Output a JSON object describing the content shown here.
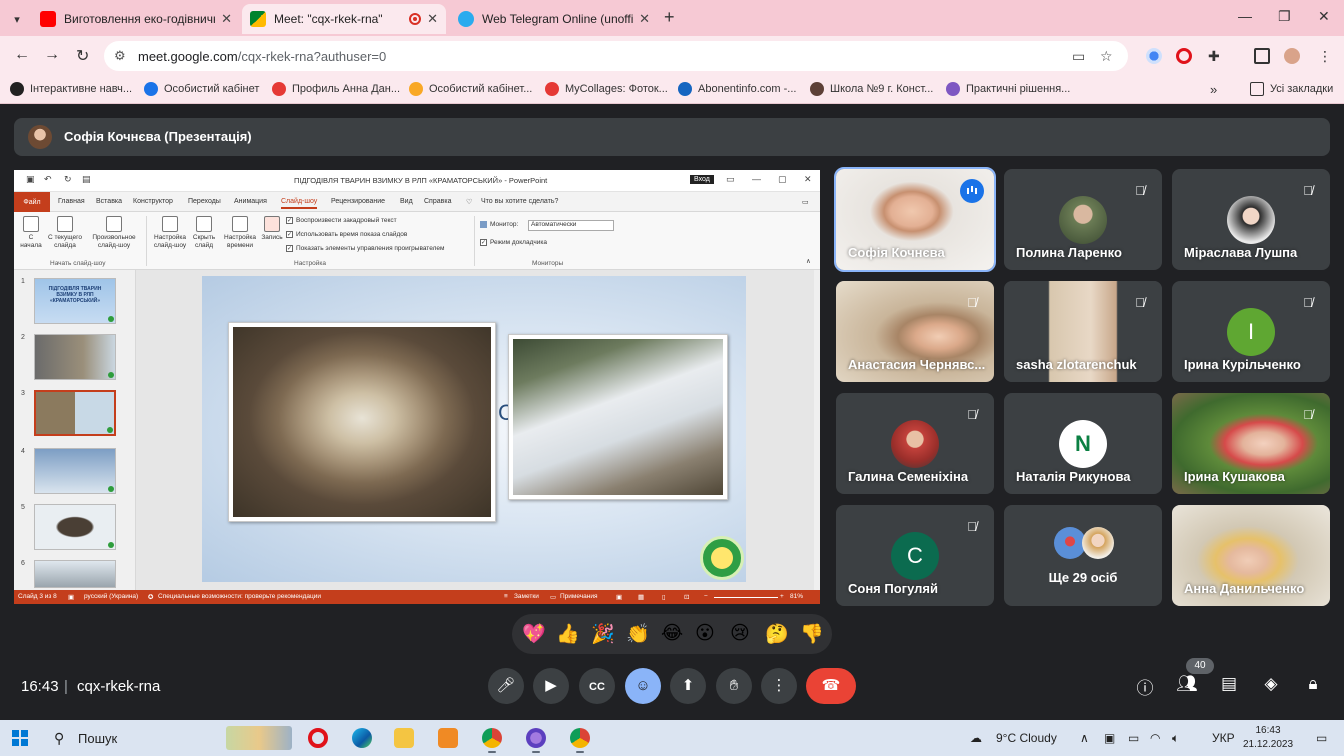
{
  "browser": {
    "tabs": [
      {
        "title": "Виготовлення еко-годівничк",
        "icon": "youtube-icon",
        "color": "#ff0000"
      },
      {
        "title": "Meet: \"cqx-rkek-rna\"",
        "icon": "meet-icon",
        "color": "#00832d",
        "active": true
      },
      {
        "title": "Web Telegram Online (unoffici",
        "icon": "telegram-icon",
        "color": "#2aabee"
      }
    ],
    "url_host": "meet.google.com",
    "url_path": "/cqx-rkek-rna?authuser=0",
    "bookmarks": [
      {
        "label": "Інтерактивне навч...",
        "color": "#222222"
      },
      {
        "label": "Особистий кабінет",
        "color": "#1a73e8"
      },
      {
        "label": "Профиль Анна Дан...",
        "color": "#e53935"
      },
      {
        "label": "Особистий кабінет...",
        "color": "#f9a825"
      },
      {
        "label": "MyCollages: Фоток...",
        "color": "#e53935"
      },
      {
        "label": "Abonentinfo.com -...",
        "color": "#1565c0"
      },
      {
        "label": "Школа №9 г. Конст...",
        "color": "#5d4037"
      },
      {
        "label": "Практичні рішення...",
        "color": "#7e57c2"
      }
    ],
    "all_bookmarks": "Усі закладки"
  },
  "meet": {
    "presenter": "Софія Кочнєва (Презентація)",
    "time": "16:43",
    "code": "cqx-rkek-rna",
    "participant_count": "40",
    "more_people": "Ще 29 осіб",
    "participants": [
      {
        "name": "Софія Кочнєва",
        "speaking": true
      },
      {
        "name": "Полина Ларенко"
      },
      {
        "name": "Міраслава Лушпа"
      },
      {
        "name": "Анастасия Чернявс..."
      },
      {
        "name": "sasha zlotarenchuk"
      },
      {
        "name": "Ірина Курільченко",
        "initial": "I",
        "color": "#5fa732"
      },
      {
        "name": "Галина Семеніхіна"
      },
      {
        "name": "Наталія Рикунова",
        "initial": "N"
      },
      {
        "name": "Ірина Кушакова"
      },
      {
        "name": "Соня Погуляй",
        "initial": "C",
        "color": "#0b6b4f"
      },
      {
        "name": "Анна Данильченко"
      }
    ],
    "reactions": [
      "💖",
      "👍",
      "🎉",
      "👏",
      "😂",
      "😮",
      "😢",
      "🤔",
      "👎"
    ]
  },
  "ppt": {
    "doc_title": "ПІДГОДІВЛЯ ТВАРИН ВЗИМКУ В РЛП «КРАМАТОРСЬКИЙ» - PowerPoint",
    "login": "Вход",
    "tabs": [
      "Файл",
      "Главная",
      "Вставка",
      "Конструктор",
      "Переходы",
      "Анимация",
      "Слайд-шоу",
      "Рецензирование",
      "Вид",
      "Справка"
    ],
    "tell_me": "Что вы хотите сделать?",
    "ribbon": {
      "from_start": "С начала",
      "from_current": "С текущего слайда",
      "custom": "Произвольное слайд-шоу",
      "group_start": "Начать слайд-шоу",
      "setup": "Настройка слайд-шоу",
      "hide": "Скрыть слайд",
      "timing": "Настройка времени",
      "record": "Запись",
      "check_narration": "Воспроизвести закадровый текст",
      "check_timings": "Использовать время показа слайдов",
      "check_controls": "Показать элементы управления проигрывателем",
      "group_setup": "Настройка",
      "monitor_label": "Монитор:",
      "monitor_value": "Автоматически",
      "presenter_view": "Режим докладчика",
      "group_monitors": "Мониторы"
    },
    "thumb1_text": "ПІДГОДІВЛЯ ТВАРИН ВЗИМКУ В РЛП «КРАМАТОРСЬКИЙ»",
    "slide_letter": "С",
    "status": {
      "slide": "Слайд 3 из 8",
      "lang": "русский (Украина)",
      "access": "Специальные возможности: проверьте рекомендации",
      "notes": "Заметки",
      "comments": "Примечания",
      "zoom": "81%"
    }
  },
  "taskbar": {
    "search": "Пошук",
    "weather": "9°C  Cloudy",
    "lang": "УКР",
    "time": "16:43",
    "date": "21.12.2023"
  }
}
